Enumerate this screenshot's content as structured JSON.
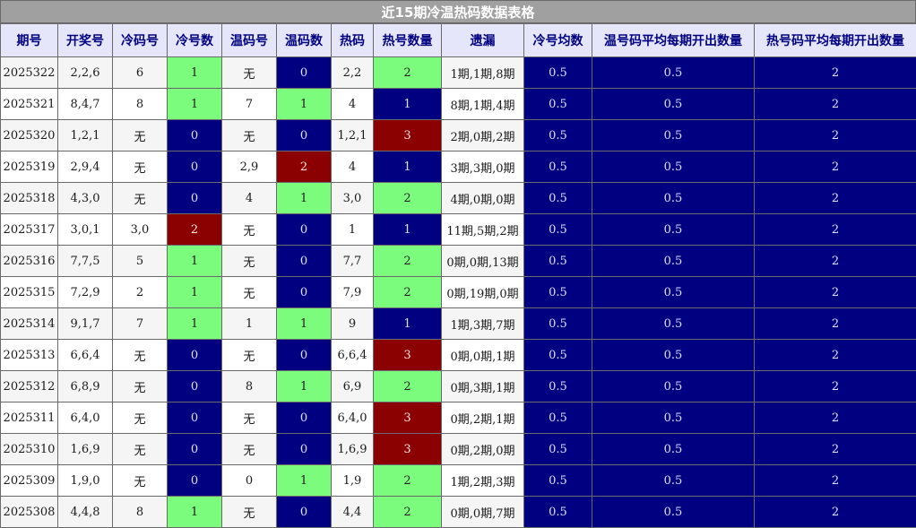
{
  "title": "近15期冷温热码数据表格",
  "headers": [
    "期号",
    "开奖号",
    "冷码号",
    "冷号数",
    "温码号",
    "温码数",
    "热码",
    "热号数量",
    "遗漏",
    "冷号均数",
    "温号码平均每期开出数量",
    "热号码平均每期开出数量"
  ],
  "colors": {
    "navy": "#000080",
    "green": "#7cfc7c",
    "red": "#8b0000",
    "header_bg": "#e6e6fa",
    "title_bg": "#a0a0a0"
  },
  "rows": [
    [
      "2025322",
      "2,2,6",
      "6",
      "1",
      "无",
      "0",
      "2,2",
      "2",
      "1期,1期,8期",
      "0.5",
      "0.5",
      "2"
    ],
    [
      "2025321",
      "8,4,7",
      "8",
      "1",
      "7",
      "1",
      "4",
      "1",
      "8期,1期,4期",
      "0.5",
      "0.5",
      "2"
    ],
    [
      "2025320",
      "1,2,1",
      "无",
      "0",
      "无",
      "0",
      "1,2,1",
      "3",
      "2期,0期,2期",
      "0.5",
      "0.5",
      "2"
    ],
    [
      "2025319",
      "2,9,4",
      "无",
      "0",
      "2,9",
      "2",
      "4",
      "1",
      "3期,3期,0期",
      "0.5",
      "0.5",
      "2"
    ],
    [
      "2025318",
      "4,3,0",
      "无",
      "0",
      "4",
      "1",
      "3,0",
      "2",
      "4期,0期,0期",
      "0.5",
      "0.5",
      "2"
    ],
    [
      "2025317",
      "3,0,1",
      "3,0",
      "2",
      "无",
      "0",
      "1",
      "1",
      "11期,5期,2期",
      "0.5",
      "0.5",
      "2"
    ],
    [
      "2025316",
      "7,7,5",
      "5",
      "1",
      "无",
      "0",
      "7,7",
      "2",
      "0期,0期,13期",
      "0.5",
      "0.5",
      "2"
    ],
    [
      "2025315",
      "7,2,9",
      "2",
      "1",
      "无",
      "0",
      "7,9",
      "2",
      "0期,19期,0期",
      "0.5",
      "0.5",
      "2"
    ],
    [
      "2025314",
      "9,1,7",
      "7",
      "1",
      "1",
      "1",
      "9",
      "1",
      "1期,3期,7期",
      "0.5",
      "0.5",
      "2"
    ],
    [
      "2025313",
      "6,6,4",
      "无",
      "0",
      "无",
      "0",
      "6,6,4",
      "3",
      "0期,0期,1期",
      "0.5",
      "0.5",
      "2"
    ],
    [
      "2025312",
      "6,8,9",
      "无",
      "0",
      "8",
      "1",
      "6,9",
      "2",
      "0期,3期,1期",
      "0.5",
      "0.5",
      "2"
    ],
    [
      "2025311",
      "6,4,0",
      "无",
      "0",
      "无",
      "0",
      "6,4,0",
      "3",
      "0期,2期,1期",
      "0.5",
      "0.5",
      "2"
    ],
    [
      "2025310",
      "1,6,9",
      "无",
      "0",
      "无",
      "0",
      "1,6,9",
      "3",
      "0期,2期,0期",
      "0.5",
      "0.5",
      "2"
    ],
    [
      "2025309",
      "1,9,0",
      "无",
      "0",
      "0",
      "1",
      "1,9",
      "2",
      "1期,2期,3期",
      "0.5",
      "0.5",
      "2"
    ],
    [
      "2025308",
      "4,4,8",
      "8",
      "1",
      "无",
      "0",
      "4,4",
      "2",
      "0期,0期,7期",
      "0.5",
      "0.5",
      "2"
    ]
  ]
}
